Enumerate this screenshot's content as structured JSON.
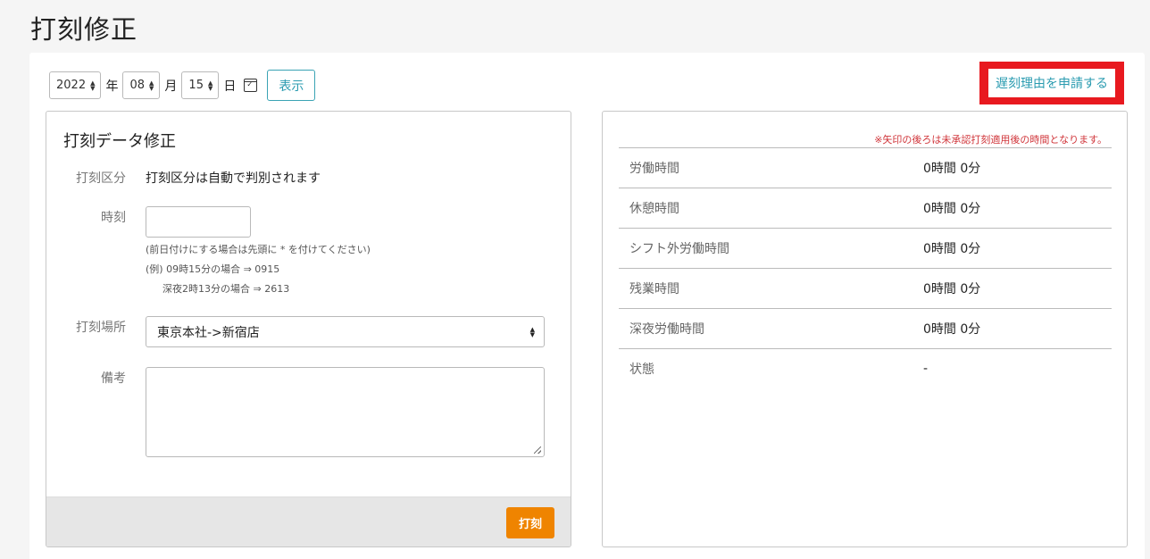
{
  "page": {
    "title": "打刻修正"
  },
  "toolbar": {
    "year": "2022",
    "year_unit": "年",
    "month": "08",
    "month_unit": "月",
    "day": "15",
    "day_unit": "日",
    "calendar_icon": "calendar-icon",
    "show_label": "表示",
    "late_reason_link": "遅刻理由を申請する"
  },
  "form": {
    "title": "打刻データ修正",
    "type_label": "打刻区分",
    "type_value": "打刻区分は自動で判別されます",
    "time_label": "時刻",
    "time_value": "",
    "hint1": "(前日付けにする場合は先頭に * を付けてください)",
    "hint2": "(例) 09時15分の場合 ⇒ 0915",
    "hint3": "深夜2時13分の場合 ⇒ 2613",
    "place_label": "打刻場所",
    "place_value": "東京本社->新宿店",
    "memo_label": "備考",
    "memo_value": "",
    "submit_label": "打刻"
  },
  "summary": {
    "note": "※矢印の後ろは未承認打刻適用後の時間となります。",
    "rows": [
      {
        "label": "労働時間",
        "value": "0時間 0分"
      },
      {
        "label": "休憩時間",
        "value": "0時間 0分"
      },
      {
        "label": "シフト外労働時間",
        "value": "0時間 0分"
      },
      {
        "label": "残業時間",
        "value": "0時間 0分"
      },
      {
        "label": "深夜労働時間",
        "value": "0時間 0分"
      },
      {
        "label": "状態",
        "value": "-"
      }
    ]
  },
  "colors": {
    "accent": "#2a9bb0",
    "submit": "#ef8400",
    "highlight": "#e8191f",
    "note": "#d0353a"
  }
}
